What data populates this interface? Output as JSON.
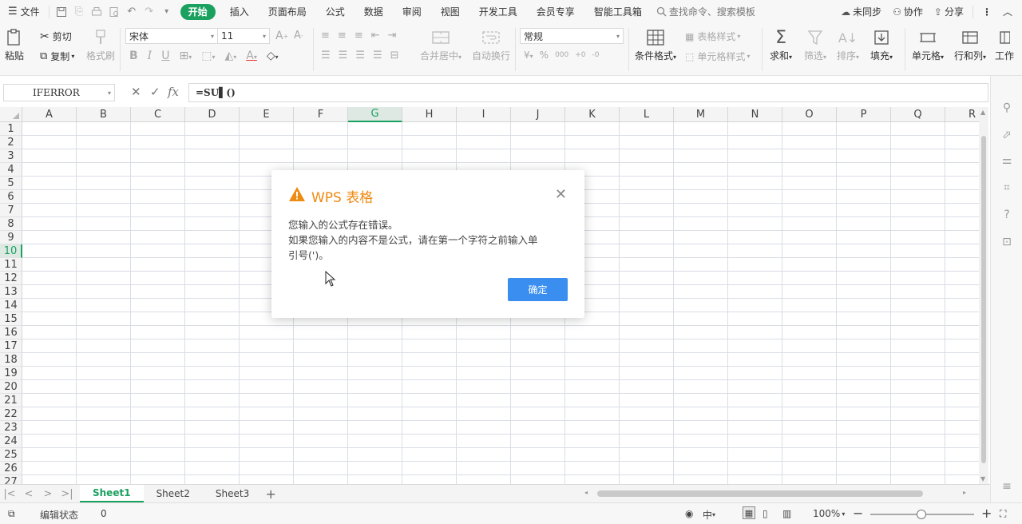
{
  "menubar": {
    "menu_label": "文件",
    "tabs": [
      "开始",
      "插入",
      "页面布局",
      "公式",
      "数据",
      "审阅",
      "视图",
      "开发工具",
      "会员专享",
      "智能工具箱"
    ],
    "active_tab_index": 0,
    "search_placeholder": "查找命令、搜索模板",
    "sync_label": "未同步",
    "collab_label": "协作",
    "share_label": "分享"
  },
  "ribbon": {
    "paste": "粘贴",
    "cut": "剪切",
    "copy": "复制",
    "format_painter": "格式刷",
    "font_name": "宋体",
    "font_size": "11",
    "number_format": "常规",
    "merge_center": "合并居中",
    "wrap_text": "自动换行",
    "conditional_format": "条件格式",
    "table_style": "表格样式",
    "cell_style": "单元格样式",
    "sum": "求和",
    "filter": "筛选",
    "sort": "排序",
    "fill": "填充",
    "cell": "单元格",
    "row_col": "行和列",
    "worksheet": "工作"
  },
  "formula_bar": {
    "name_box": "IFERROR",
    "fx_label": "fx",
    "formula": "=SU▌()"
  },
  "grid": {
    "columns": [
      "A",
      "B",
      "C",
      "D",
      "E",
      "F",
      "G",
      "H",
      "I",
      "J",
      "K",
      "L",
      "M",
      "N",
      "O",
      "P",
      "Q",
      "R"
    ],
    "selected_column": "G",
    "rows": [
      "1",
      "2",
      "3",
      "4",
      "5",
      "6",
      "7",
      "8",
      "9",
      "10",
      "11",
      "12",
      "13",
      "14",
      "15",
      "16",
      "17",
      "18",
      "19",
      "20",
      "21",
      "22",
      "23",
      "24",
      "25",
      "26",
      "27"
    ],
    "selected_row": "10"
  },
  "sheets": {
    "tabs": [
      "Sheet1",
      "Sheet2",
      "Sheet3"
    ],
    "active_index": 0
  },
  "statusbar": {
    "mode": "编辑状态",
    "value": "0",
    "zoom": "100%"
  },
  "dialog": {
    "title": "WPS 表格",
    "line1": "您输入的公式存在错误。",
    "line2": "如果您输入的内容不是公式，请在第一个字符之前输入单",
    "line3": "引号(')。",
    "ok_label": "确定"
  },
  "colors": {
    "accent_green": "#1aa05f",
    "dialog_title": "#ef8a12",
    "ok_button": "#3a8ef0"
  }
}
